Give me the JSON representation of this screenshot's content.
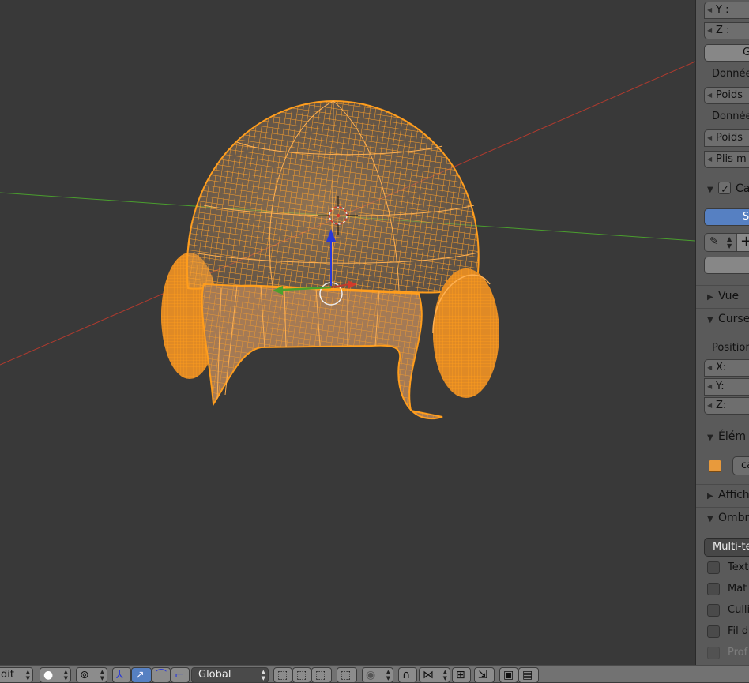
{
  "viewport": {
    "name": "3D viewport - edit mode",
    "object_color": "#ff9a1f",
    "axis_x_color": "#c33a2f",
    "axis_y_color": "#4a9e2e",
    "axis_z_color": "#2a39d8"
  },
  "npanel": {
    "y_label": "Y :",
    "z_label": "Z :",
    "g_button": "G",
    "data_label_1": "Donnée",
    "weight_1": "Poids",
    "data_label_2": "Donnée",
    "weight_2": "Poids",
    "creases": "Plis m",
    "section_ca": "Ca",
    "blue_button": "Se",
    "section_view": "Vue",
    "section_cursor": "Curse",
    "position_label": "Position",
    "x_label": "X:",
    "y2_label": "Y:",
    "z2_label": "Z:",
    "section_item": "Élém",
    "object_name": "ca",
    "section_display": "Affich",
    "section_shading": "Ombr",
    "shading_select": "Multi-te",
    "check_1": "Text",
    "check_2": "Mat",
    "check_3": "Culli",
    "check_4": "Fil d",
    "check_5": "Prof"
  },
  "header": {
    "mode_tail": "dit",
    "orientation": "Global"
  }
}
